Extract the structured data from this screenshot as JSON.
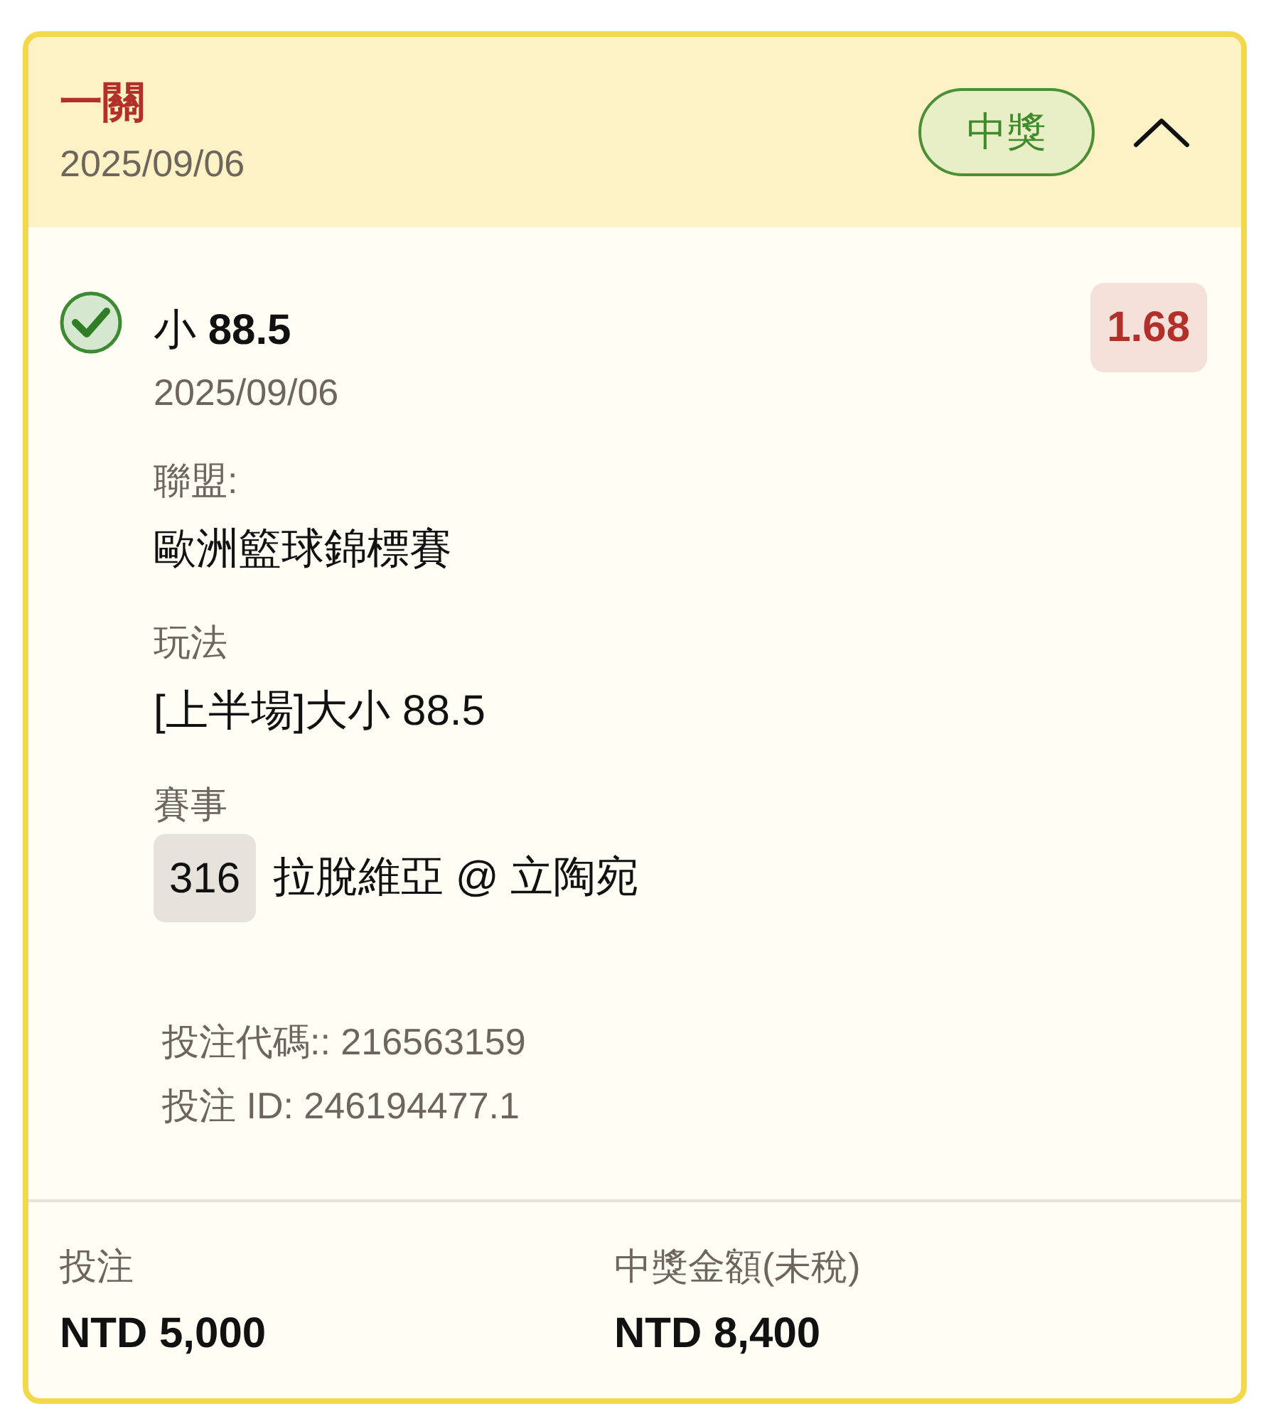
{
  "slip": {
    "title": "一關",
    "date": "2025/09/06",
    "status_badge": "中獎",
    "expanded": true
  },
  "selection": {
    "won": true,
    "pick": "小 **88.5**",
    "date": "2025/09/06",
    "odds": "1.68",
    "fields": [
      {
        "kind": "text",
        "label": "聯盟:",
        "value": "歐洲籃球錦標賽"
      },
      {
        "kind": "text",
        "label": "玩法",
        "value": "[上半場]大小 88.5"
      },
      {
        "kind": "match",
        "label": "賽事",
        "match_no": "316",
        "value": "拉脫維亞 @ 立陶宛"
      }
    ]
  },
  "bet_refs": [
    "投注代碼:: 216563159",
    "投注 ID: 246194477.1"
  ],
  "summary": [
    {
      "label": "投注",
      "amount": "NTD 5,000"
    },
    {
      "label": "中獎金額(未稅)",
      "amount": "NTD 8,400"
    }
  ]
}
